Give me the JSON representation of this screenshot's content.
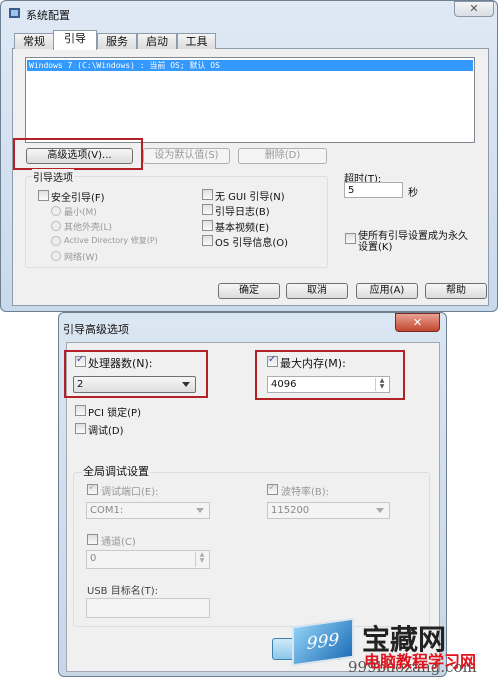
{
  "main_window": {
    "title": "系统配置",
    "tabs": [
      {
        "label": "常规"
      },
      {
        "label": "引导",
        "active": true
      },
      {
        "label": "服务"
      },
      {
        "label": "启动"
      },
      {
        "label": "工具"
      }
    ],
    "boot_list": [
      "Windows 7 (C:\\Windows) : 当前 OS; 默认 OS"
    ],
    "buttons": {
      "advanced": "高级选项(V)...",
      "set_default": "设为默认值(S)",
      "delete": "删除(D)",
      "ok": "确定",
      "cancel": "取消",
      "apply": "应用(A)",
      "help": "帮助"
    },
    "boot_options": {
      "group_label": "引导选项",
      "safe_boot": "安全引导(F)",
      "minimal": "最小(M)",
      "alternate_shell": "其他外壳(L)",
      "ad_repair": "Active Directory 修复(P)",
      "network": "网络(W)",
      "no_gui": "无 GUI 引导(N)",
      "boot_log": "引导日志(B)",
      "base_video": "基本视频(E)",
      "os_info": "OS 引导信息(O)"
    },
    "timeout": {
      "label": "超时(T):",
      "value": "5",
      "unit": "秒"
    },
    "permanent": "使所有引导设置成为永久设置(K)"
  },
  "advanced_dialog": {
    "title": "引导高级选项",
    "num_processors": {
      "label": "处理器数(N):",
      "checked": true,
      "value": "2"
    },
    "max_memory": {
      "label": "最大内存(M):",
      "checked": true,
      "value": "4096"
    },
    "pci_lock": {
      "label": "PCI 锁定(P)",
      "checked": false
    },
    "debug": {
      "label": "调试(D)",
      "checked": false
    },
    "global_debug": {
      "group_label": "全局调试设置",
      "debug_port": {
        "label": "调试端口(E):",
        "value": "COM1:"
      },
      "baud_rate": {
        "label": "波特率(B):",
        "value": "115200"
      },
      "channel": {
        "label": "通道(C)",
        "value": "0"
      },
      "usb_target": {
        "label": "USB 目标名(T):",
        "value": ""
      }
    }
  },
  "watermark": {
    "brand": "宝藏网",
    "subtitle": "电脑教程学习网",
    "url": "999baozang.com",
    "logo_text": "999"
  },
  "colors": {
    "highlight": "#3399ff",
    "annotation_red": "#b32025"
  }
}
